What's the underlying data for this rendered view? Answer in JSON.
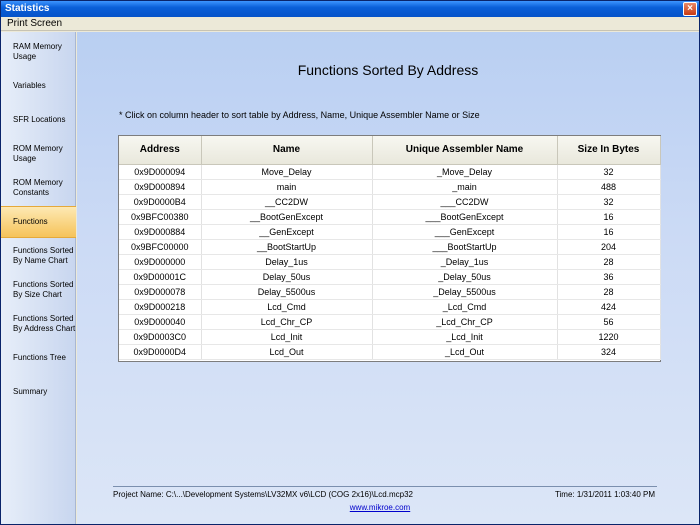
{
  "window": {
    "title": "Statistics",
    "close_label": "×"
  },
  "menu": {
    "print_screen": "Print Screen"
  },
  "sidebar": {
    "items": [
      {
        "label": "RAM Memory Usage",
        "active": false
      },
      {
        "label": "Variables",
        "active": false
      },
      {
        "label": "SFR Locations",
        "active": false
      },
      {
        "label": "ROM Memory Usage",
        "active": false
      },
      {
        "label": "ROM Memory Constants",
        "active": false
      },
      {
        "label": "Functions",
        "active": true
      },
      {
        "label": "Functions Sorted By Name Chart",
        "active": false
      },
      {
        "label": "Functions Sorted By Size Chart",
        "active": false
      },
      {
        "label": "Functions Sorted By Address Chart",
        "active": false
      },
      {
        "label": "Functions Tree",
        "active": false
      },
      {
        "label": "Summary",
        "active": false
      }
    ]
  },
  "main": {
    "title": "Functions Sorted By Address",
    "hint": "* Click on column header to sort table by Address, Name, Unique Assembler Name or Size",
    "table": {
      "headers": [
        "Address",
        "Name",
        "Unique Assembler Name",
        "Size In Bytes"
      ],
      "rows": [
        [
          "0x9D000094",
          "Move_Delay",
          "_Move_Delay",
          "32"
        ],
        [
          "0x9D000894",
          "main",
          "_main",
          "488"
        ],
        [
          "0x9D0000B4",
          "__CC2DW",
          "___CC2DW",
          "32"
        ],
        [
          "0x9BFC00380",
          "__BootGenExcept",
          "___BootGenExcept",
          "16"
        ],
        [
          "0x9D000884",
          "__GenExcept",
          "___GenExcept",
          "16"
        ],
        [
          "0x9BFC00000",
          "__BootStartUp",
          "___BootStartUp",
          "204"
        ],
        [
          "0x9D000000",
          "Delay_1us",
          "_Delay_1us",
          "28"
        ],
        [
          "0x9D00001C",
          "Delay_50us",
          "_Delay_50us",
          "36"
        ],
        [
          "0x9D000078",
          "Delay_5500us",
          "_Delay_5500us",
          "28"
        ],
        [
          "0x9D000218",
          "Lcd_Cmd",
          "_Lcd_Cmd",
          "424"
        ],
        [
          "0x9D000040",
          "Lcd_Chr_CP",
          "_Lcd_Chr_CP",
          "56"
        ],
        [
          "0x9D0003C0",
          "Lcd_Init",
          "_Lcd_Init",
          "1220"
        ],
        [
          "0x9D0000D4",
          "Lcd_Out",
          "_Lcd_Out",
          "324"
        ]
      ]
    }
  },
  "footer": {
    "project": "Project Name: C:\\...\\Development Systems\\LV32MX v6\\LCD (COG 2x16)\\Lcd.mcp32",
    "time": "Time: 1/31/2011 1:03:40 PM",
    "link": "www.mikroe.com"
  }
}
